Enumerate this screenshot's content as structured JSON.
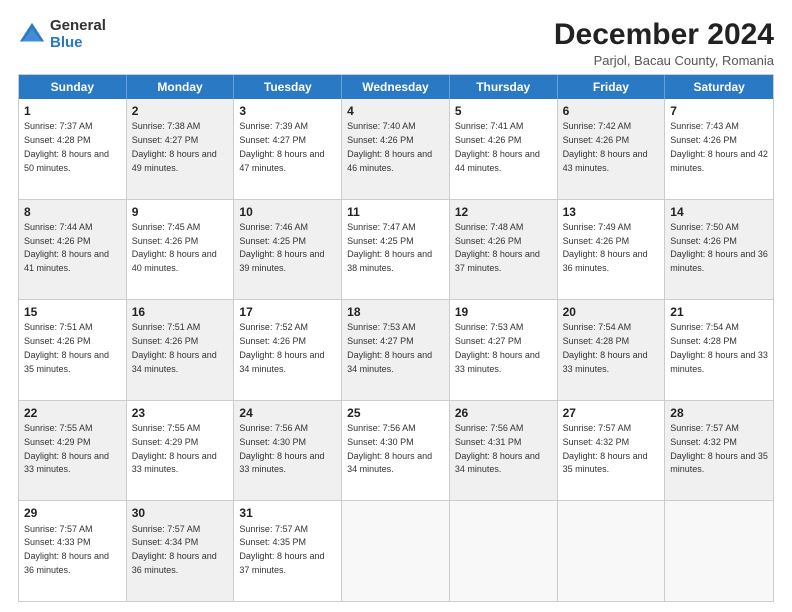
{
  "logo": {
    "general": "General",
    "blue": "Blue"
  },
  "title": "December 2024",
  "subtitle": "Parjol, Bacau County, Romania",
  "header_days": [
    "Sunday",
    "Monday",
    "Tuesday",
    "Wednesday",
    "Thursday",
    "Friday",
    "Saturday"
  ],
  "weeks": [
    [
      {
        "day": "1",
        "sunrise": "Sunrise: 7:37 AM",
        "sunset": "Sunset: 4:28 PM",
        "daylight": "Daylight: 8 hours and 50 minutes.",
        "shaded": false
      },
      {
        "day": "2",
        "sunrise": "Sunrise: 7:38 AM",
        "sunset": "Sunset: 4:27 PM",
        "daylight": "Daylight: 8 hours and 49 minutes.",
        "shaded": true
      },
      {
        "day": "3",
        "sunrise": "Sunrise: 7:39 AM",
        "sunset": "Sunset: 4:27 PM",
        "daylight": "Daylight: 8 hours and 47 minutes.",
        "shaded": false
      },
      {
        "day": "4",
        "sunrise": "Sunrise: 7:40 AM",
        "sunset": "Sunset: 4:26 PM",
        "daylight": "Daylight: 8 hours and 46 minutes.",
        "shaded": true
      },
      {
        "day": "5",
        "sunrise": "Sunrise: 7:41 AM",
        "sunset": "Sunset: 4:26 PM",
        "daylight": "Daylight: 8 hours and 44 minutes.",
        "shaded": false
      },
      {
        "day": "6",
        "sunrise": "Sunrise: 7:42 AM",
        "sunset": "Sunset: 4:26 PM",
        "daylight": "Daylight: 8 hours and 43 minutes.",
        "shaded": true
      },
      {
        "day": "7",
        "sunrise": "Sunrise: 7:43 AM",
        "sunset": "Sunset: 4:26 PM",
        "daylight": "Daylight: 8 hours and 42 minutes.",
        "shaded": false
      }
    ],
    [
      {
        "day": "8",
        "sunrise": "Sunrise: 7:44 AM",
        "sunset": "Sunset: 4:26 PM",
        "daylight": "Daylight: 8 hours and 41 minutes.",
        "shaded": true
      },
      {
        "day": "9",
        "sunrise": "Sunrise: 7:45 AM",
        "sunset": "Sunset: 4:26 PM",
        "daylight": "Daylight: 8 hours and 40 minutes.",
        "shaded": false
      },
      {
        "day": "10",
        "sunrise": "Sunrise: 7:46 AM",
        "sunset": "Sunset: 4:25 PM",
        "daylight": "Daylight: 8 hours and 39 minutes.",
        "shaded": true
      },
      {
        "day": "11",
        "sunrise": "Sunrise: 7:47 AM",
        "sunset": "Sunset: 4:25 PM",
        "daylight": "Daylight: 8 hours and 38 minutes.",
        "shaded": false
      },
      {
        "day": "12",
        "sunrise": "Sunrise: 7:48 AM",
        "sunset": "Sunset: 4:26 PM",
        "daylight": "Daylight: 8 hours and 37 minutes.",
        "shaded": true
      },
      {
        "day": "13",
        "sunrise": "Sunrise: 7:49 AM",
        "sunset": "Sunset: 4:26 PM",
        "daylight": "Daylight: 8 hours and 36 minutes.",
        "shaded": false
      },
      {
        "day": "14",
        "sunrise": "Sunrise: 7:50 AM",
        "sunset": "Sunset: 4:26 PM",
        "daylight": "Daylight: 8 hours and 36 minutes.",
        "shaded": true
      }
    ],
    [
      {
        "day": "15",
        "sunrise": "Sunrise: 7:51 AM",
        "sunset": "Sunset: 4:26 PM",
        "daylight": "Daylight: 8 hours and 35 minutes.",
        "shaded": false
      },
      {
        "day": "16",
        "sunrise": "Sunrise: 7:51 AM",
        "sunset": "Sunset: 4:26 PM",
        "daylight": "Daylight: 8 hours and 34 minutes.",
        "shaded": true
      },
      {
        "day": "17",
        "sunrise": "Sunrise: 7:52 AM",
        "sunset": "Sunset: 4:26 PM",
        "daylight": "Daylight: 8 hours and 34 minutes.",
        "shaded": false
      },
      {
        "day": "18",
        "sunrise": "Sunrise: 7:53 AM",
        "sunset": "Sunset: 4:27 PM",
        "daylight": "Daylight: 8 hours and 34 minutes.",
        "shaded": true
      },
      {
        "day": "19",
        "sunrise": "Sunrise: 7:53 AM",
        "sunset": "Sunset: 4:27 PM",
        "daylight": "Daylight: 8 hours and 33 minutes.",
        "shaded": false
      },
      {
        "day": "20",
        "sunrise": "Sunrise: 7:54 AM",
        "sunset": "Sunset: 4:28 PM",
        "daylight": "Daylight: 8 hours and 33 minutes.",
        "shaded": true
      },
      {
        "day": "21",
        "sunrise": "Sunrise: 7:54 AM",
        "sunset": "Sunset: 4:28 PM",
        "daylight": "Daylight: 8 hours and 33 minutes.",
        "shaded": false
      }
    ],
    [
      {
        "day": "22",
        "sunrise": "Sunrise: 7:55 AM",
        "sunset": "Sunset: 4:29 PM",
        "daylight": "Daylight: 8 hours and 33 minutes.",
        "shaded": true
      },
      {
        "day": "23",
        "sunrise": "Sunrise: 7:55 AM",
        "sunset": "Sunset: 4:29 PM",
        "daylight": "Daylight: 8 hours and 33 minutes.",
        "shaded": false
      },
      {
        "day": "24",
        "sunrise": "Sunrise: 7:56 AM",
        "sunset": "Sunset: 4:30 PM",
        "daylight": "Daylight: 8 hours and 33 minutes.",
        "shaded": true
      },
      {
        "day": "25",
        "sunrise": "Sunrise: 7:56 AM",
        "sunset": "Sunset: 4:30 PM",
        "daylight": "Daylight: 8 hours and 34 minutes.",
        "shaded": false
      },
      {
        "day": "26",
        "sunrise": "Sunrise: 7:56 AM",
        "sunset": "Sunset: 4:31 PM",
        "daylight": "Daylight: 8 hours and 34 minutes.",
        "shaded": true
      },
      {
        "day": "27",
        "sunrise": "Sunrise: 7:57 AM",
        "sunset": "Sunset: 4:32 PM",
        "daylight": "Daylight: 8 hours and 35 minutes.",
        "shaded": false
      },
      {
        "day": "28",
        "sunrise": "Sunrise: 7:57 AM",
        "sunset": "Sunset: 4:32 PM",
        "daylight": "Daylight: 8 hours and 35 minutes.",
        "shaded": true
      }
    ],
    [
      {
        "day": "29",
        "sunrise": "Sunrise: 7:57 AM",
        "sunset": "Sunset: 4:33 PM",
        "daylight": "Daylight: 8 hours and 36 minutes.",
        "shaded": false
      },
      {
        "day": "30",
        "sunrise": "Sunrise: 7:57 AM",
        "sunset": "Sunset: 4:34 PM",
        "daylight": "Daylight: 8 hours and 36 minutes.",
        "shaded": true
      },
      {
        "day": "31",
        "sunrise": "Sunrise: 7:57 AM",
        "sunset": "Sunset: 4:35 PM",
        "daylight": "Daylight: 8 hours and 37 minutes.",
        "shaded": false
      },
      {
        "day": "",
        "sunrise": "",
        "sunset": "",
        "daylight": "",
        "shaded": false,
        "empty": true
      },
      {
        "day": "",
        "sunrise": "",
        "sunset": "",
        "daylight": "",
        "shaded": false,
        "empty": true
      },
      {
        "day": "",
        "sunrise": "",
        "sunset": "",
        "daylight": "",
        "shaded": false,
        "empty": true
      },
      {
        "day": "",
        "sunrise": "",
        "sunset": "",
        "daylight": "",
        "shaded": false,
        "empty": true
      }
    ]
  ]
}
